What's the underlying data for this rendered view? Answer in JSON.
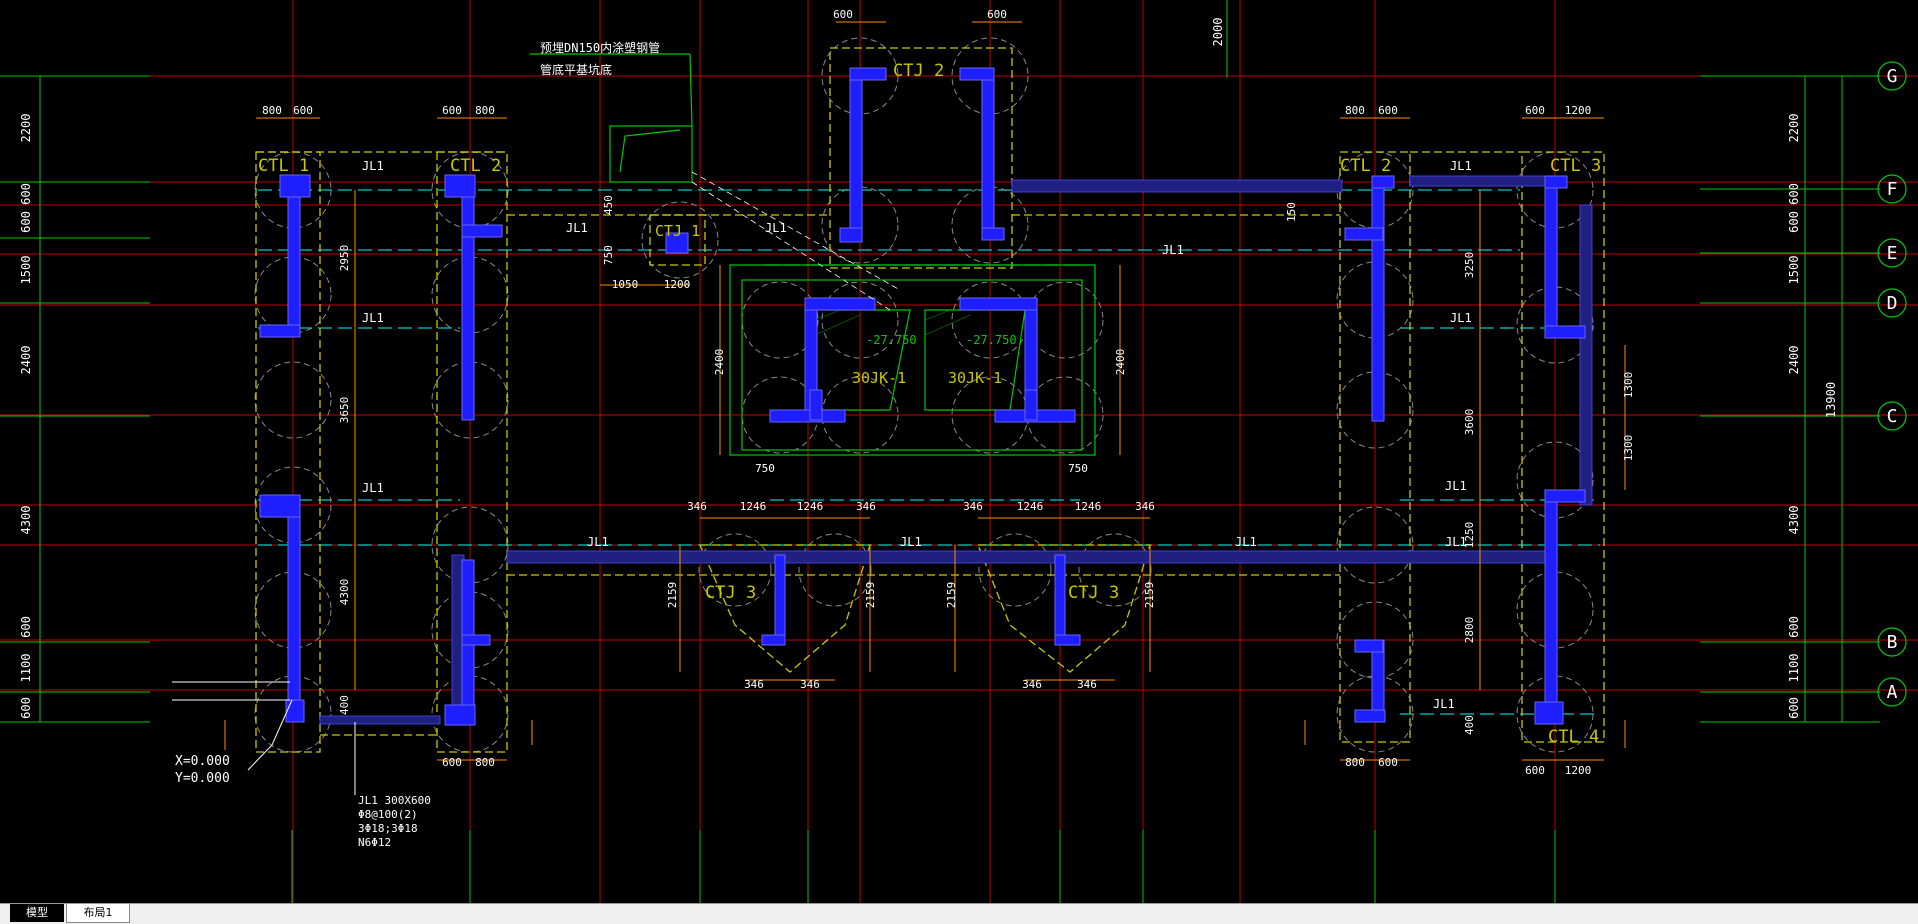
{
  "tabs": [
    {
      "label": "模型",
      "active": true
    },
    {
      "label": "布局1",
      "active": false
    }
  ],
  "axes": [
    {
      "label": "G"
    },
    {
      "label": "F"
    },
    {
      "label": "E"
    },
    {
      "label": "D"
    },
    {
      "label": "C"
    },
    {
      "label": "B"
    },
    {
      "label": "A"
    }
  ],
  "dims_left": [
    "2200",
    "600",
    "600",
    "1500",
    "2400",
    "4300",
    "600",
    "1100",
    "600"
  ],
  "dims_right": [
    "2200",
    "600",
    "600",
    "1500",
    "2400",
    "4300",
    "600",
    "1100",
    "600"
  ],
  "overall_dim": "13900",
  "top_dim": "2000",
  "caps": {
    "ctl1_left": "CTL 1",
    "ctl2_left": "CTL 2",
    "ctj1": "CTJ 1",
    "ctj2": "CTJ 2",
    "ctl2_right": "CTL 2",
    "ctl3": "CTL 3",
    "ctl4": "CTL 4",
    "ctj3_left": "CTJ 3",
    "ctj3_right": "CTJ 3"
  },
  "pit_labels": [
    "30JK-1",
    "30JK-1"
  ],
  "pit_elevations": [
    "-27.750",
    "-27.750"
  ],
  "beam_label": "JL1",
  "note": [
    "预埋DN150内涂塑钢管",
    "管底平基坑底"
  ],
  "origin": [
    "X=0.000",
    "Y=0.000"
  ],
  "beam_spec": [
    "JL1 300X600",
    "Φ8@100(2)",
    "3Φ18;3Φ18",
    "N6Φ12"
  ],
  "dim_texts": {
    "w800": "800",
    "w600": "600",
    "w1200": "1200",
    "w1050": "1050",
    "w750": "750",
    "w346": "346",
    "w1246": "1246",
    "v2950": "2950",
    "v3650": "3650",
    "v4300": "4300",
    "v400": "400",
    "v3250": "3250",
    "v3600": "3600",
    "v1250": "1250",
    "v2800": "2800",
    "v1300": "1300",
    "v2400": "2400",
    "v2159": "2159",
    "v450": "450",
    "v150": "150"
  },
  "colors": {
    "grid": "#c00000",
    "wall": "#1e1eff",
    "cap": "#c8c800",
    "green": "#00c800",
    "dim": "#ff8c00",
    "beam": "#00c8c8",
    "white": "#ffffff",
    "magenta": "#e000e0"
  }
}
